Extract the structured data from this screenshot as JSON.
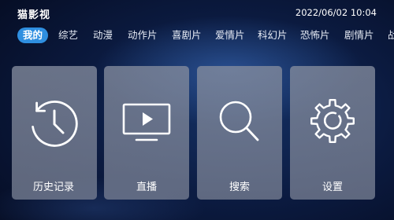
{
  "app": {
    "title": "猫影视",
    "datetime": "2022/06/02 10:04"
  },
  "tabs": [
    {
      "label": "我的",
      "active": true
    },
    {
      "label": "综艺"
    },
    {
      "label": "动漫"
    },
    {
      "label": "动作片"
    },
    {
      "label": "喜剧片"
    },
    {
      "label": "爱情片"
    },
    {
      "label": "科幻片"
    },
    {
      "label": "恐怖片"
    },
    {
      "label": "剧情片"
    },
    {
      "label": "战"
    }
  ],
  "cards": [
    {
      "label": "历史记录",
      "icon": "history-icon"
    },
    {
      "label": "直播",
      "icon": "tv-play-icon"
    },
    {
      "label": "搜索",
      "icon": "search-icon"
    },
    {
      "label": "设置",
      "icon": "gear-icon"
    }
  ],
  "colors": {
    "accent": "#2f8fe0",
    "card": "#848c9e",
    "background": "#0b1a3f"
  }
}
